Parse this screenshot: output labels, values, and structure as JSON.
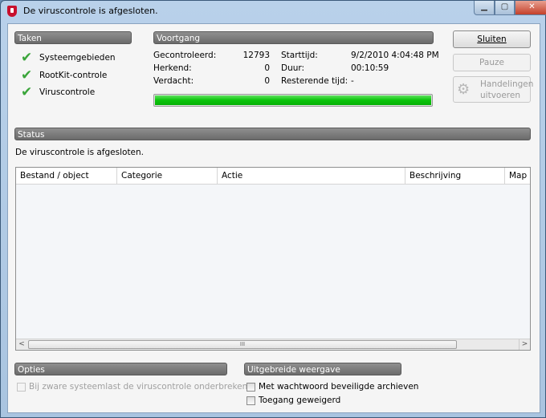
{
  "window": {
    "title": "De viruscontrole is afgesloten.",
    "controls": {
      "minimize": "▁",
      "maximize": "▢",
      "close": "✕"
    }
  },
  "tasks": {
    "header": "Taken",
    "items": [
      {
        "label": "Systeemgebieden",
        "done": true
      },
      {
        "label": "RootKit-controle",
        "done": true
      },
      {
        "label": "Viruscontrole",
        "done": true
      }
    ]
  },
  "progress": {
    "header": "Voortgang",
    "stats": [
      {
        "label": "Gecontroleerd:",
        "value": "12793"
      },
      {
        "label": "Herkend:",
        "value": "0"
      },
      {
        "label": "Verdacht:",
        "value": "0"
      }
    ],
    "times": [
      {
        "label": "Starttijd:",
        "value": "9/2/2010 4:04:48 PM"
      },
      {
        "label": "Duur:",
        "value": "00:10:59"
      },
      {
        "label": "Resterende tijd:",
        "value": "-"
      }
    ],
    "percent": 100,
    "bar_color": "#0ac40a"
  },
  "buttons": {
    "close": "Sluiten",
    "pause": "Pauze",
    "actions_line1": "Handelingen",
    "actions_line2": "uitvoeren"
  },
  "status": {
    "header": "Status",
    "message": "De viruscontrole is afgesloten."
  },
  "table": {
    "columns": [
      "Bestand / object",
      "Categorie",
      "Actie",
      "Beschrijving",
      "Map"
    ],
    "rows": [],
    "scroll_grip": "III",
    "scroll_left": "<",
    "scroll_right": ">"
  },
  "options": {
    "header": "Opties",
    "items": [
      {
        "label": "Bij zware systeemlast de viruscontrole onderbreken",
        "checked": false,
        "disabled": true
      }
    ]
  },
  "extended": {
    "header": "Uitgebreide weergave",
    "items": [
      {
        "label": "Met wachtwoord beveiligde archieven",
        "checked": false
      },
      {
        "label": "Toegang geweigerd",
        "checked": false
      }
    ]
  }
}
